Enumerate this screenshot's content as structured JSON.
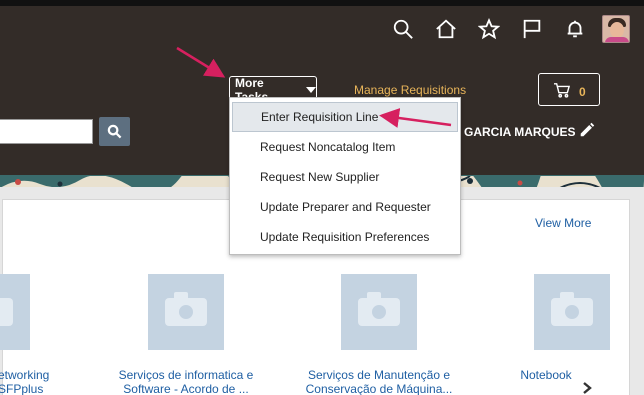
{
  "header": {
    "icons": [
      "search-icon",
      "home-icon",
      "star-icon",
      "flag-icon",
      "bell-icon"
    ],
    "more_tasks_label": "More Tasks",
    "manage_requisitions_label": "Manage Requisitions",
    "cart_count": "0",
    "user_name": "GARCIA MARQUES",
    "search_value": ""
  },
  "menu": {
    "items": [
      {
        "label": "Enter Requisition Line"
      },
      {
        "label": "Request Noncatalog Item"
      },
      {
        "label": "Request New Supplier"
      },
      {
        "label": "Update Preparer and Requester"
      },
      {
        "label": "Update Requisition Preferences"
      }
    ]
  },
  "catalog": {
    "view_more_label": "View More",
    "items": [
      {
        "line1": "etworking",
        "line2": "SFPplus"
      },
      {
        "line1": "Serviços de informatica e",
        "line2": "Software - Acordo de ..."
      },
      {
        "line1": "Serviços de Manutenção e",
        "line2": "Conservação de Máquina..."
      },
      {
        "line1": "Notebook",
        "line2": ""
      }
    ]
  },
  "colors": {
    "header_bg": "#332c28",
    "link_gold": "#e8b55a",
    "link_blue": "#1f5fa3",
    "annotation_arrow": "#d6205f"
  }
}
